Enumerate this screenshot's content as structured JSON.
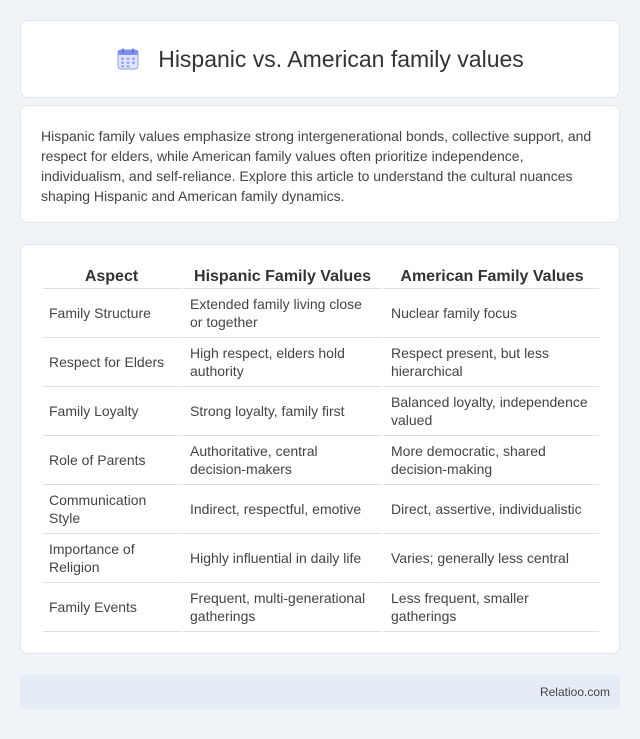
{
  "header": {
    "icon": "calendar-icon",
    "title": "Hispanic vs. American family values"
  },
  "intro": {
    "text": "Hispanic family values emphasize strong intergenerational bonds, collective support, and respect for elders, while American family values often prioritize independence, individualism, and self-reliance. Explore this article to understand the cultural nuances shaping Hispanic and American family dynamics."
  },
  "table": {
    "headers": [
      "Aspect",
      "Hispanic Family Values",
      "American Family Values"
    ],
    "rows": [
      [
        "Family Structure",
        "Extended family living close or together",
        "Nuclear family focus"
      ],
      [
        "Respect for Elders",
        "High respect, elders hold authority",
        "Respect present, but less hierarchical"
      ],
      [
        "Family Loyalty",
        "Strong loyalty, family first",
        "Balanced loyalty, independence valued"
      ],
      [
        "Role of Parents",
        "Authoritative, central decision-makers",
        "More democratic, shared decision-making"
      ],
      [
        "Communication Style",
        "Indirect, respectful, emotive",
        "Direct, assertive, individualistic"
      ],
      [
        "Importance of Religion",
        "Highly influential in daily life",
        "Varies; generally less central"
      ],
      [
        "Family Events",
        "Frequent, multi-generational gatherings",
        "Less frequent, smaller gatherings"
      ]
    ]
  },
  "footer": {
    "brand": "Relatioo.com"
  },
  "colors": {
    "background": "#f0f3f8",
    "card": "#ffffff",
    "footer": "#e6ecf6",
    "icon_accent": "#7b8ff0"
  }
}
